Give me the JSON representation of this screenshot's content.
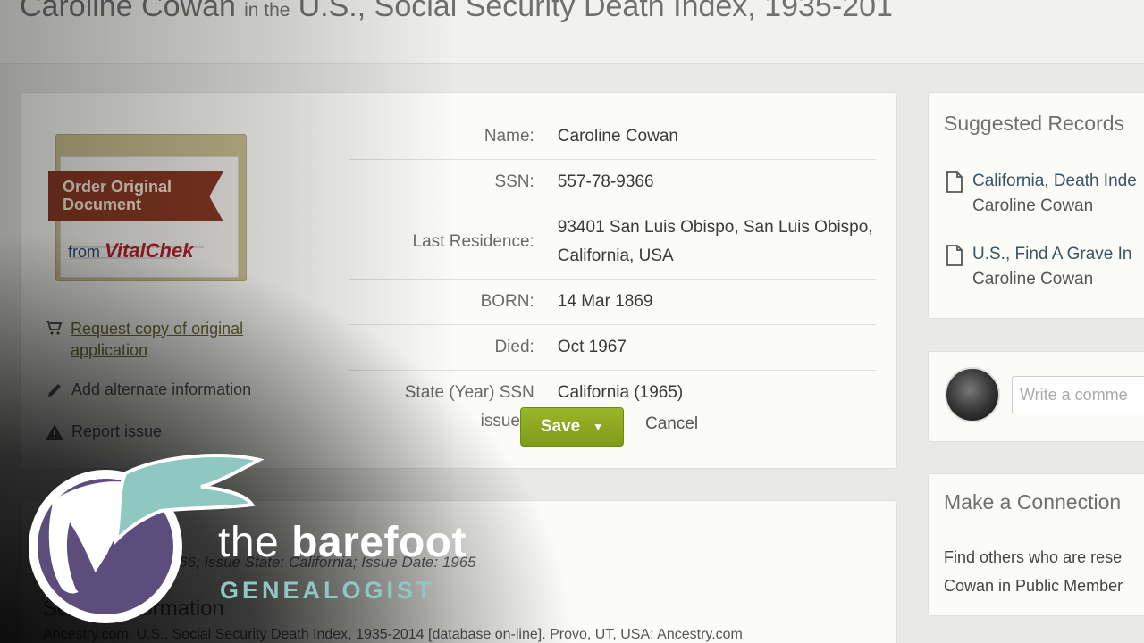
{
  "header": {
    "name": "Caroline Cowan",
    "connector": "in the",
    "collection": "U.S., Social Security Death Index, 1935-201"
  },
  "order_badge": {
    "ribbon_text": "Order Original Document",
    "from_text": "from",
    "brand": "VitalChek"
  },
  "sidebar": {
    "request_link": "Request copy of original application",
    "alternate_link": "Add alternate information",
    "report_link": "Report issue"
  },
  "details": [
    {
      "label": "Name:",
      "value": "Caroline Cowan"
    },
    {
      "label": "SSN:",
      "value": "557-78-9366"
    },
    {
      "label": "Last Residence:",
      "value": "93401 San Luis Obispo, San Luis Obispo, California, USA"
    },
    {
      "label": "BORN:",
      "value": "14 Mar 1869"
    },
    {
      "label": "Died:",
      "value": "Oct 1967"
    },
    {
      "label": "State (Year) SSN issued:",
      "value": "California (1965)"
    }
  ],
  "actions": {
    "save_label": "Save",
    "cancel_label": "Cancel"
  },
  "citation": {
    "line1": "66; Issue State: California; Issue Date: 1965",
    "heading": "Source Information",
    "line2": "Ancestry.com. U.S., Social Security Death Index, 1935-2014 [database on-line]. Provo, UT, USA: Ancestry.com"
  },
  "suggested": {
    "title": "Suggested Records",
    "items": [
      {
        "title": "California, Death Inde",
        "name": "Caroline Cowan"
      },
      {
        "title": "U.S., Find A Grave In",
        "name": "Caroline Cowan"
      }
    ]
  },
  "comment": {
    "placeholder": "Write a comme"
  },
  "connection": {
    "title": "Make a Connection",
    "line1": "Find others who are rese",
    "line2": "Cowan in Public Member"
  },
  "logo": {
    "word1": "the",
    "word2": "barefoot",
    "sub": "GENEALOGIST",
    "colors": {
      "teal": "#8fc7c1",
      "purple": "#5c4d7d",
      "white": "#ffffff"
    }
  },
  "colors": {
    "save_button": "#8ba81f",
    "link_olive": "#6c6c38",
    "ribbon": "#8a3a24"
  }
}
